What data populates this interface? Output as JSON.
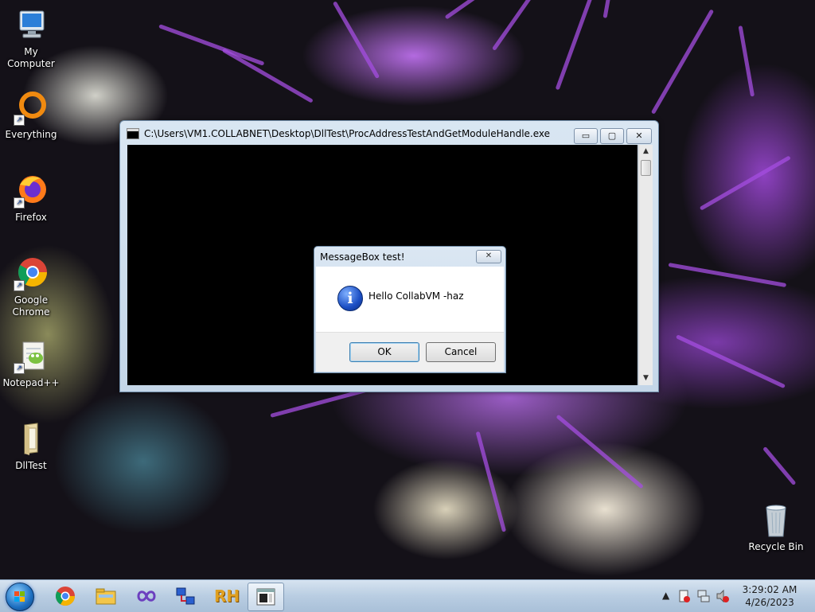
{
  "desktop": {
    "icons": [
      {
        "label": "My Computer",
        "icon": "computer-icon"
      },
      {
        "label": "Everything",
        "icon": "everything-icon"
      },
      {
        "label": "Firefox",
        "icon": "firefox-icon"
      },
      {
        "label": "Google Chrome",
        "icon": "chrome-icon"
      },
      {
        "label": "Notepad++",
        "icon": "notepadpp-icon"
      },
      {
        "label": "DllTest",
        "icon": "folder-icon"
      },
      {
        "label": "Recycle Bin",
        "icon": "recycle-bin-icon"
      }
    ]
  },
  "console": {
    "title": "C:\\Users\\VM1.COLLABNET\\Desktop\\DllTest\\ProcAddressTestAndGetModuleHandle.exe",
    "minimize": "▭",
    "maximize": "▢",
    "close": "✕"
  },
  "msgbox": {
    "title": "MessageBox test!",
    "close": "✕",
    "icon_letter": "i",
    "message": "Hello CollabVM -haz",
    "ok_label": "OK",
    "cancel_label": "Cancel"
  },
  "taskbar": {
    "pinned": [
      "chrome-icon",
      "explorer-icon",
      "visual-studio-icon",
      "network-tool-icon",
      "rh-icon",
      "console-window-icon"
    ],
    "rh_text": "RH",
    "tray_arrow": "▲",
    "time": "3:29:02 AM",
    "date": "4/26/2023"
  },
  "colors": {
    "accent": "#a44ee0",
    "title_bar": "#c4d6e8"
  }
}
